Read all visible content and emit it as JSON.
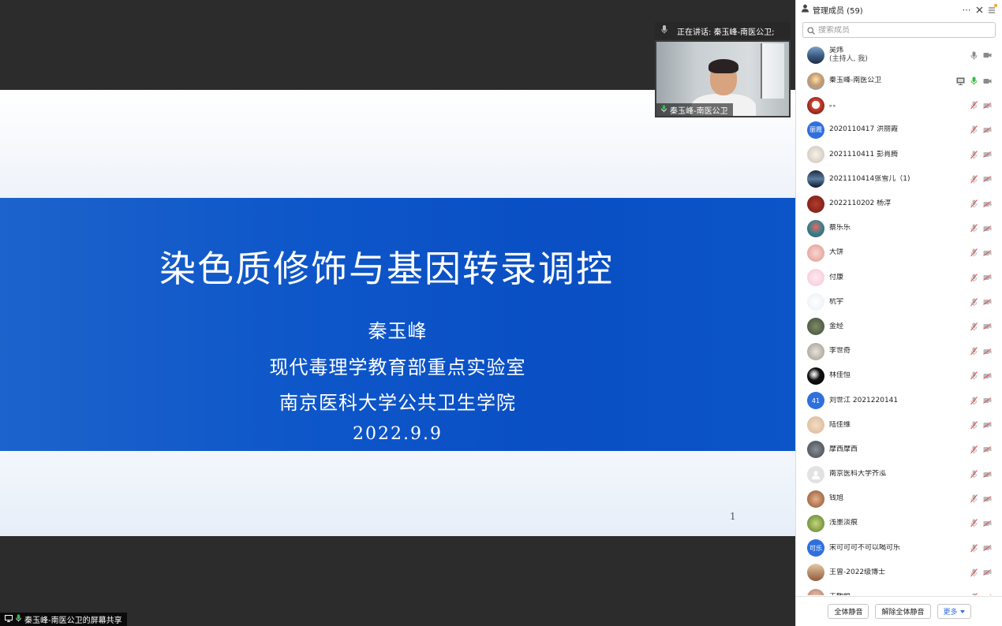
{
  "stage": {
    "speaking_label": "正在讲话: 秦玉峰-南医公卫;",
    "video_name": "秦玉峰-南医公卫",
    "share_label": "秦玉峰-南医公卫的屏幕共享"
  },
  "slide": {
    "title": "染色质修饰与基因转录调控",
    "author": "秦玉峰",
    "lab": "现代毒理学教育部重点实验室",
    "school": "南京医科大学公共卫生学院",
    "date": "2022.9.9",
    "page_number": "1"
  },
  "panel": {
    "title": "管理成员 (59)",
    "search_placeholder": "搜索成员",
    "members": [
      {
        "name": "吴炜",
        "sub": "(主持人, 我)",
        "mic": "on",
        "avatar": "landscape"
      },
      {
        "name": "秦玉峰-南医公卫",
        "sub": "",
        "mic": "active",
        "screen": true,
        "avatar": "cartoon"
      },
      {
        "name": "。。",
        "sub": "",
        "mic": "muted",
        "avatar": "cartoon-red"
      },
      {
        "name": "2020110417 洪丽霞",
        "sub": "",
        "mic": "muted",
        "avatar_text": "丽霞",
        "avatar": "blue"
      },
      {
        "name": "2021110411 彭肖腾",
        "sub": "",
        "mic": "muted",
        "avatar": "dog"
      },
      {
        "name": "2021110414张雪儿（1)",
        "sub": "",
        "mic": "muted",
        "avatar": "night"
      },
      {
        "name": "2022110202 杨淳",
        "sub": "",
        "mic": "muted",
        "avatar": "darkred"
      },
      {
        "name": "蔡乐乐",
        "sub": "",
        "mic": "muted",
        "avatar": "teal"
      },
      {
        "name": "大饼",
        "sub": "",
        "mic": "muted",
        "avatar": "pig"
      },
      {
        "name": "付康",
        "sub": "",
        "mic": "muted",
        "avatar": "pink"
      },
      {
        "name": "杭宇",
        "sub": "",
        "mic": "muted",
        "avatar": "white"
      },
      {
        "name": "金经",
        "sub": "",
        "mic": "muted",
        "avatar": "olive"
      },
      {
        "name": "李世奇",
        "sub": "",
        "mic": "muted",
        "avatar": "gray"
      },
      {
        "name": "林佳恒",
        "sub": "",
        "mic": "muted",
        "avatar": "black"
      },
      {
        "name": "刘世江 2021220141",
        "sub": "",
        "mic": "muted",
        "avatar_text": "41",
        "avatar": "blue"
      },
      {
        "name": "陆佳维",
        "sub": "",
        "mic": "muted",
        "avatar": "beige"
      },
      {
        "name": "摩西摩西",
        "sub": "",
        "mic": "muted",
        "avatar": "dark"
      },
      {
        "name": "南京医科大学齐泓",
        "sub": "",
        "mic": "muted",
        "avatar": "default"
      },
      {
        "name": "钱旭",
        "sub": "",
        "mic": "muted",
        "avatar": "brown"
      },
      {
        "name": "浅墨淡痕",
        "sub": "",
        "mic": "muted",
        "avatar": "green"
      },
      {
        "name": "宋可可可不可以喝可乐",
        "sub": "",
        "mic": "muted",
        "avatar_text": "可乐",
        "avatar": "blue"
      },
      {
        "name": "王曾-2022级博士",
        "sub": "",
        "mic": "muted",
        "avatar": "sunset"
      },
      {
        "name": "王敏悦",
        "sub": "",
        "mic": "muted",
        "avatar": "rose"
      }
    ],
    "footer": {
      "mute_all": "全体静音",
      "unmute_all": "解除全体静音",
      "more": "更多"
    }
  },
  "colors": {
    "slide_blue": "#0d56c9",
    "accent_blue": "#2f6fde",
    "mic_active": "#3cb846",
    "mic_muted": "#e24c4c",
    "notification_dot": "#f5a623"
  }
}
